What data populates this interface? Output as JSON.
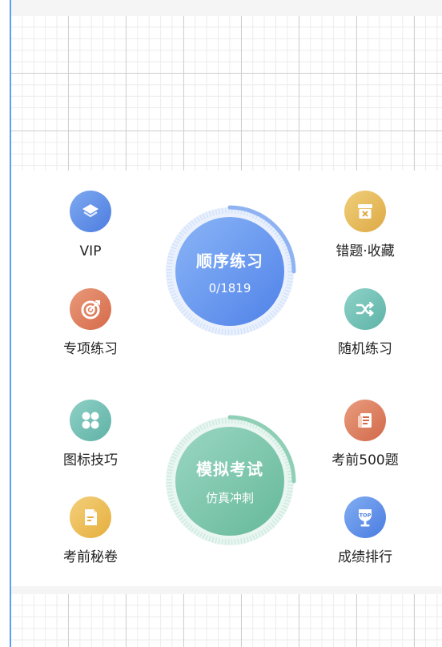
{
  "left_features": [
    {
      "label": "VIP",
      "icon": "layers-icon",
      "color_from": "#7ea9f0",
      "color_to": "#4d7de0"
    },
    {
      "label": "专项练习",
      "icon": "target-icon",
      "color_from": "#e99a7a",
      "color_to": "#d56a4a"
    },
    {
      "label": "图标技巧",
      "icon": "four-dots-icon",
      "color_from": "#8fd0c6",
      "color_to": "#5fb2a6"
    },
    {
      "label": "考前秘卷",
      "icon": "secret-paper-icon",
      "color_from": "#f3d07a",
      "color_to": "#e6ae3e"
    }
  ],
  "right_features": [
    {
      "label": "错题·收藏",
      "icon": "error-box-icon",
      "color_from": "#f0cf7a",
      "color_to": "#dda945"
    },
    {
      "label": "随机练习",
      "icon": "shuffle-icon",
      "color_from": "#8fd2c8",
      "color_to": "#5db3a7"
    },
    {
      "label": "考前500题",
      "icon": "scroll-icon",
      "color_from": "#ea9c7e",
      "color_to": "#d1694a"
    },
    {
      "label": "成绩排行",
      "icon": "trophy-icon",
      "color_from": "#82aef3",
      "color_to": "#4a7ce0"
    }
  ],
  "sequential": {
    "title": "顺序练习",
    "progress": "0/1819",
    "color_from": "#8bb5f7",
    "color_to": "#4f82e8"
  },
  "mock_exam": {
    "title": "模拟考试",
    "subtitle": "仿真冲刺",
    "color_from": "#9ad6c2",
    "color_to": "#66b99b"
  },
  "top_icon_text": "TOP"
}
